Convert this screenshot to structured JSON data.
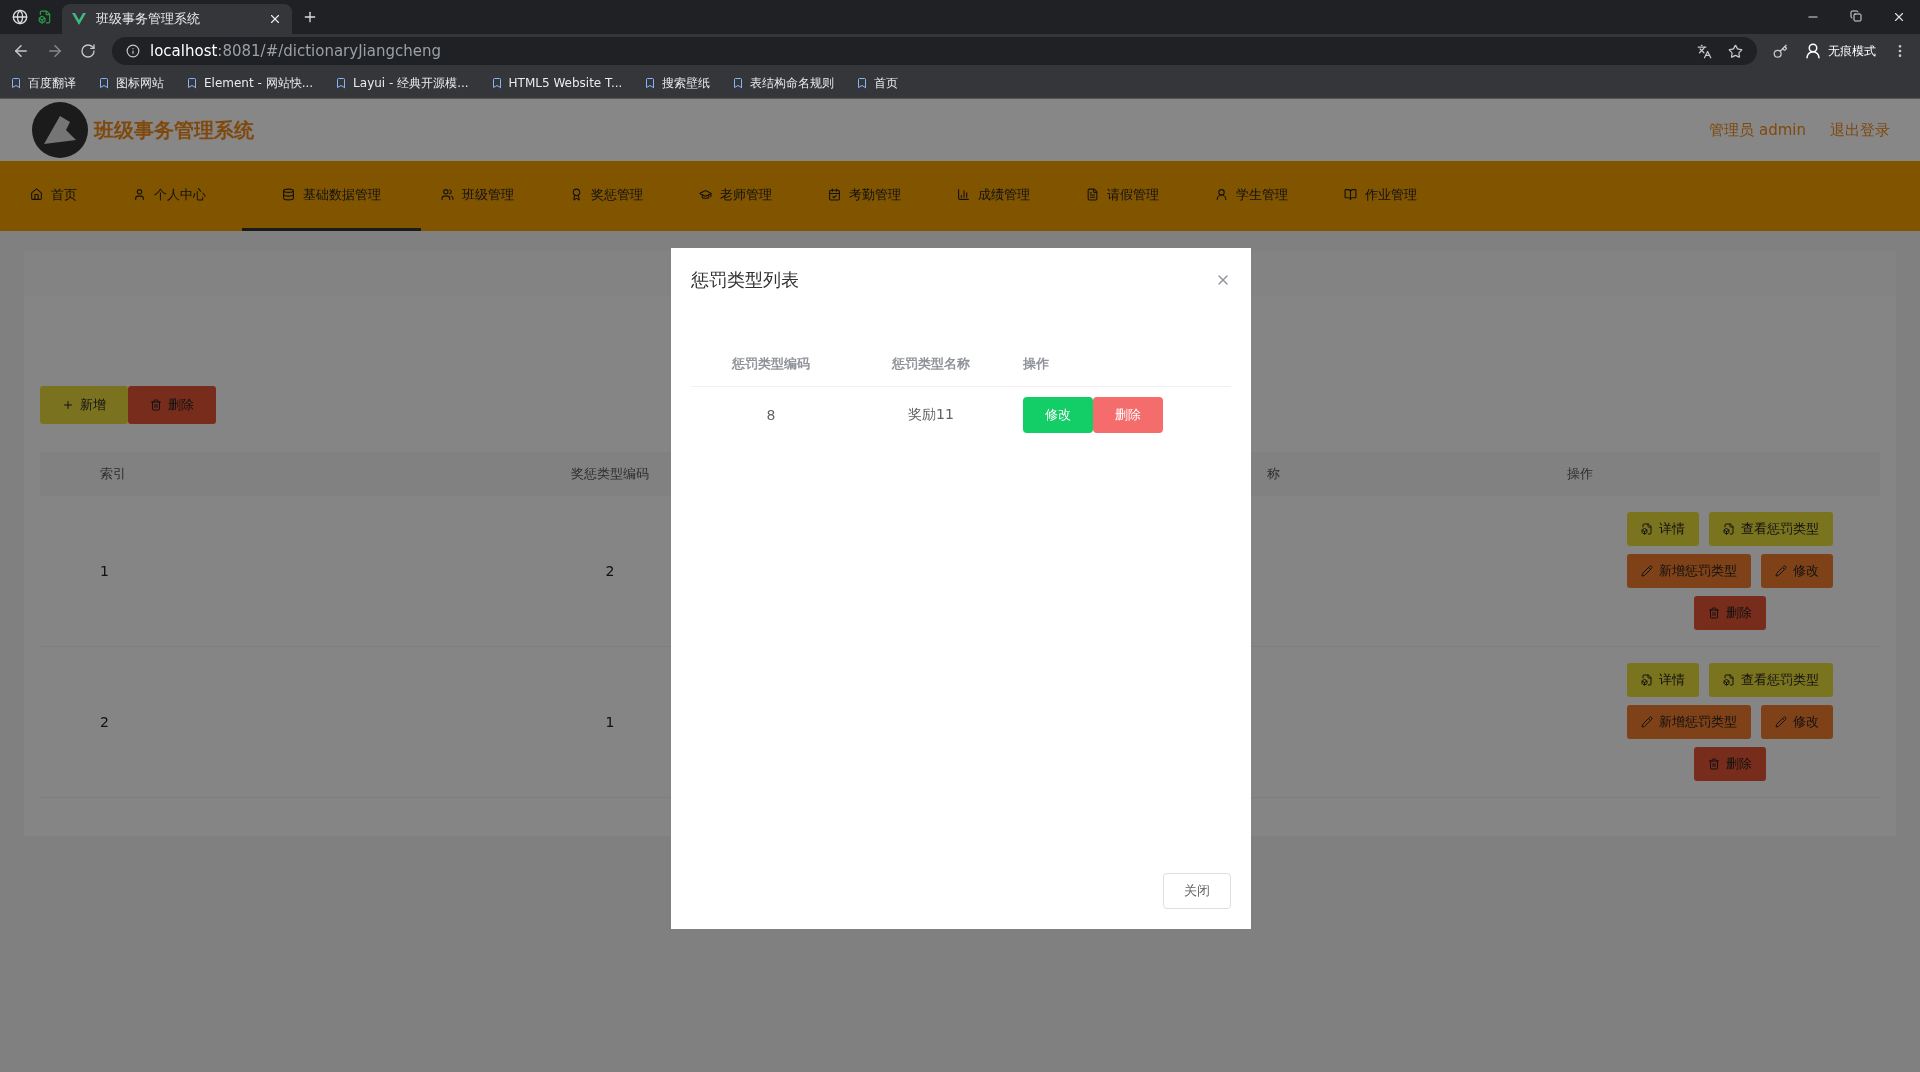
{
  "browser": {
    "tab_title": "班级事务管理系统",
    "url_host": "localhost",
    "url_rest": ":8081/#/dictionaryJiangcheng",
    "profile": "无痕模式",
    "bookmarks": [
      "百度翻译",
      "图标网站",
      "Element - 网站快...",
      "Layui - 经典开源模...",
      "HTML5 Website T...",
      "搜索壁纸",
      "表结构命名规则",
      "首页"
    ]
  },
  "header": {
    "title": "班级事务管理系统",
    "user": "管理员 admin",
    "logout": "退出登录"
  },
  "nav": [
    {
      "label": "首页",
      "selected": false
    },
    {
      "label": "个人中心",
      "selected": false
    },
    {
      "label": "基础数据管理",
      "selected": true
    },
    {
      "label": "班级管理",
      "selected": false
    },
    {
      "label": "奖惩管理",
      "selected": false
    },
    {
      "label": "老师管理",
      "selected": false
    },
    {
      "label": "考勤管理",
      "selected": false
    },
    {
      "label": "成绩管理",
      "selected": false
    },
    {
      "label": "请假管理",
      "selected": false
    },
    {
      "label": "学生管理",
      "selected": false
    },
    {
      "label": "作业管理",
      "selected": false
    }
  ],
  "toolbar": [
    {
      "label": "新增",
      "kind": "add"
    },
    {
      "label": "删除",
      "kind": "delete"
    }
  ],
  "table": {
    "columns": [
      "索引",
      "奖惩类型编码",
      "称",
      "操作"
    ],
    "rows": [
      {
        "cells": [
          "1",
          "2"
        ],
        "actions": [
          {
            "label": "详情",
            "kind": "detail"
          },
          {
            "label": "查看惩罚类型",
            "kind": "detail"
          },
          {
            "label": "新增惩罚类型",
            "kind": "edit"
          },
          {
            "label": "修改",
            "kind": "edit"
          },
          {
            "label": "删除",
            "kind": "delete"
          }
        ]
      },
      {
        "cells": [
          "2",
          "1"
        ],
        "actions": [
          {
            "label": "详情",
            "kind": "detail"
          },
          {
            "label": "查看惩罚类型",
            "kind": "detail"
          },
          {
            "label": "新增惩罚类型",
            "kind": "edit"
          },
          {
            "label": "修改",
            "kind": "edit"
          },
          {
            "label": "删除",
            "kind": "delete"
          }
        ]
      }
    ]
  },
  "dialog": {
    "title": "惩罚类型列表",
    "columns": [
      "惩罚类型编码",
      "惩罚类型名称",
      "操作"
    ],
    "rows": [
      {
        "cells": [
          "8",
          "奖励11"
        ],
        "actions": [
          {
            "label": "修改",
            "kind": "edit"
          },
          {
            "label": "删除",
            "kind": "delete"
          }
        ]
      }
    ],
    "close": "关闭"
  }
}
